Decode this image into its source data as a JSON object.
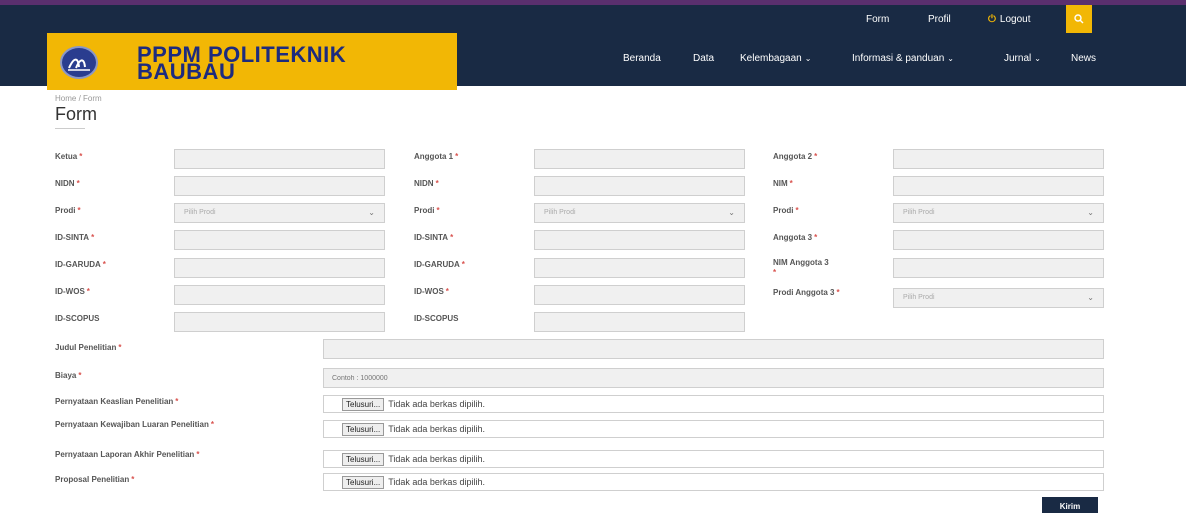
{
  "topbar": {
    "form": "Form",
    "profil": "Profil",
    "logout": "Logout"
  },
  "brand": {
    "line1": "PPPM POLITEKNIK",
    "line2": "BAUBAU"
  },
  "nav": {
    "beranda": "Beranda",
    "data": "Data",
    "kelembagaan": "Kelembagaan",
    "informasi": "Informasi & panduan",
    "jurnal": "Jurnal",
    "news": "News"
  },
  "breadcrumb": "Home  /  Form",
  "page_title": "Form",
  "columns": {
    "col1": {
      "ketua": "Ketua",
      "nidn": "NIDN",
      "prodi": "Prodi",
      "id_sinta": "ID-SINTA",
      "id_garuda": "ID-GARUDA",
      "id_wos": "ID-WOS",
      "id_scopus": "ID-SCOPUS",
      "prodi_placeholder": "Pilih Prodi"
    },
    "col2": {
      "anggota1": "Anggota 1",
      "nidn": "NIDN",
      "prodi": "Prodi",
      "id_sinta": "ID-SINTA",
      "id_garuda": "ID-GARUDA",
      "id_wos": "ID-WOS",
      "id_scopus": "ID-SCOPUS",
      "prodi_placeholder": "Pilih Prodi"
    },
    "col3": {
      "anggota2": "Anggota 2",
      "nim": "NIM",
      "prodi": "Prodi",
      "anggota3": "Anggota 3",
      "nim_anggota3": "NIM Anggota 3",
      "prodi_anggota3": "Prodi Anggota 3",
      "prodi_placeholder": "Pilih Prodi"
    }
  },
  "judul_label": "Judul Penelitian",
  "biaya_label": "Biaya",
  "biaya_placeholder": "Contoh : 1000000",
  "files": {
    "browse_label": "Telusuri...",
    "no_file_text": "Tidak ada berkas dipilih.",
    "keaslian": "Pernyataan Keaslian Penelitian",
    "kewajiban": "Pernyataan Kewajiban Luaran Penelitian",
    "laporan": "Pernyataan Laporan Akhir Penelitian",
    "proposal": "Proposal Penelitian"
  },
  "submit_label": "Kirim",
  "required_marker": "*",
  "colors": {
    "navy": "#192a44",
    "accent_yellow": "#f2b705",
    "brand_text": "#1d2b7e",
    "required_red": "#d9534f"
  }
}
